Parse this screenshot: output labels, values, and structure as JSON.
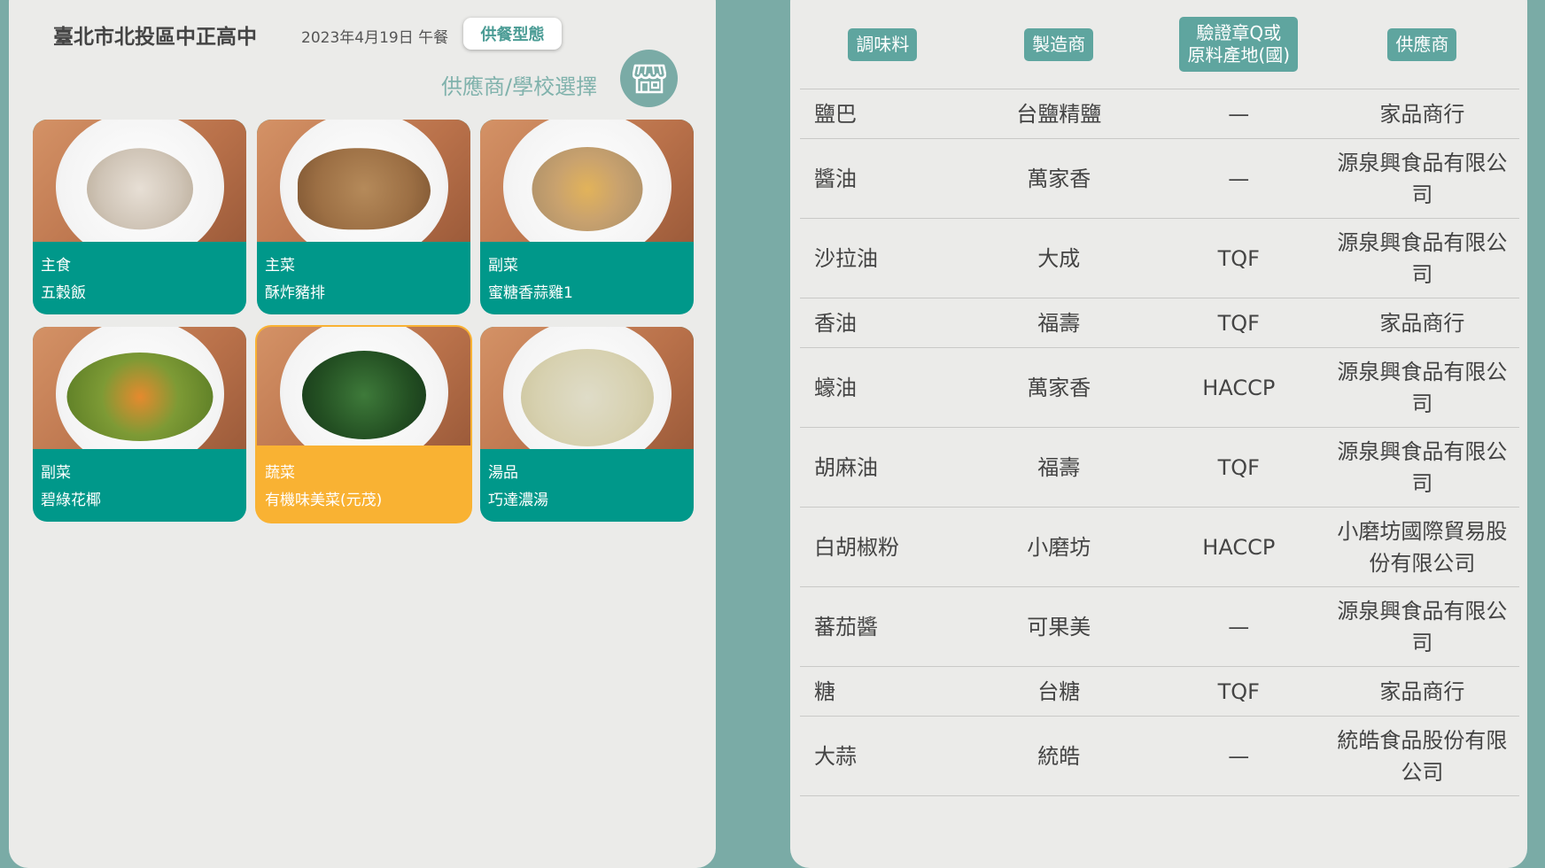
{
  "header": {
    "school": "臺北市北投區中正高中",
    "date": "2023年4月19日 午餐",
    "type_button": "供餐型態",
    "supplier_link": "供應商/學校選擇"
  },
  "dishes": [
    {
      "category": "主食",
      "name": "五穀飯",
      "highlight": false
    },
    {
      "category": "主菜",
      "name": "酥炸豬排",
      "highlight": false
    },
    {
      "category": "副菜",
      "name": "蜜糖香蒜雞1",
      "highlight": false
    },
    {
      "category": "副菜",
      "name": "碧綠花椰",
      "highlight": false
    },
    {
      "category": "蔬菜",
      "name": "有機味美菜(元茂)",
      "highlight": true
    },
    {
      "category": "湯品",
      "name": "巧達濃湯",
      "highlight": false
    }
  ],
  "table": {
    "headers": [
      "調味料",
      "製造商",
      "驗證章Q或\n原料產地(國)",
      "供應商"
    ],
    "rows": [
      [
        "鹽巴",
        "台鹽精鹽",
        "—",
        "家品商行"
      ],
      [
        "醬油",
        "萬家香",
        "—",
        "源泉興食品有限公司"
      ],
      [
        "沙拉油",
        "大成",
        "TQF",
        "源泉興食品有限公司"
      ],
      [
        "香油",
        "福壽",
        "TQF",
        "家品商行"
      ],
      [
        "蠔油",
        "萬家香",
        "HACCP",
        "源泉興食品有限公司"
      ],
      [
        "胡麻油",
        "福壽",
        "TQF",
        "源泉興食品有限公司"
      ],
      [
        "白胡椒粉",
        "小磨坊",
        "HACCP",
        "小磨坊國際貿易股份有限公司"
      ],
      [
        "蕃茄醬",
        "可果美",
        "—",
        "源泉興食品有限公司"
      ],
      [
        "糖",
        "台糖",
        "TQF",
        "家品商行"
      ],
      [
        "大蒜",
        "統皓",
        "—",
        "統皓食品股份有限公司"
      ]
    ]
  },
  "colors": {
    "teal": "#00988a",
    "highlight": "#f9b233",
    "header_badge": "#5fa59f",
    "background": "#7aaba6"
  },
  "icons": {
    "supplier": "store-icon"
  }
}
